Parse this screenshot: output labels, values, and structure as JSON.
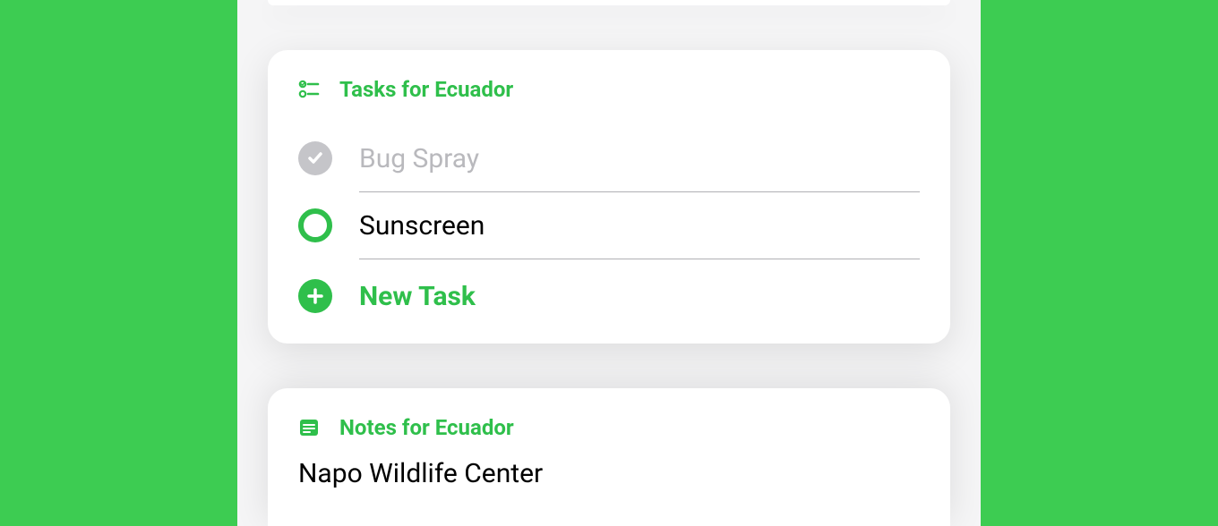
{
  "colors": {
    "accent": "#2fbf4b",
    "background": "#3dcc52"
  },
  "tasks_card": {
    "title": "Tasks for Ecuador",
    "items": [
      {
        "label": "Bug Spray",
        "completed": true
      },
      {
        "label": "Sunscreen",
        "completed": false
      }
    ],
    "new_task_label": "New Task"
  },
  "notes_card": {
    "title": "Notes for Ecuador",
    "note_text": "Napo Wildlife Center"
  }
}
